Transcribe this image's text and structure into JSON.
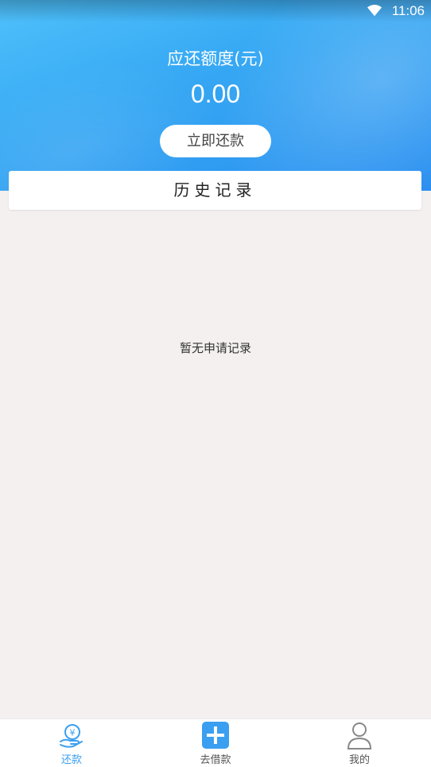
{
  "status_bar": {
    "time": "11:06",
    "wifi_icon": "wifi-icon"
  },
  "header": {
    "amount_label": "应还额度(元)",
    "amount_value": "0.00",
    "repay_button": "立即还款"
  },
  "history": {
    "title": "历史记录",
    "empty_message": "暂无申请记录"
  },
  "tabbar": {
    "items": [
      {
        "label": "还款",
        "icon": "repay-icon",
        "active": true
      },
      {
        "label": "去借款",
        "icon": "plus-icon",
        "active": false
      },
      {
        "label": "我的",
        "icon": "user-icon",
        "active": false
      }
    ]
  },
  "colors": {
    "accent": "#3a9ff0",
    "background": "#f3f0ef"
  }
}
